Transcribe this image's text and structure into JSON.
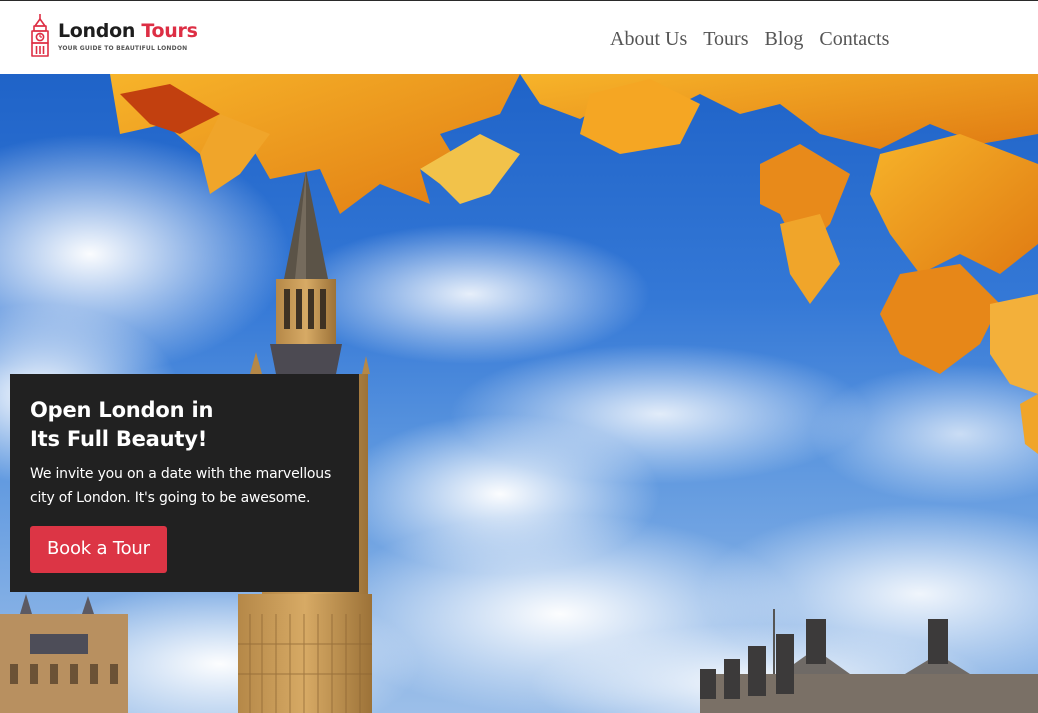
{
  "brand": {
    "title_part1": "London",
    "title_part2": "Tours",
    "tagline": "YOUR GUIDE TO BEAUTIFUL LONDON",
    "icon": "big-ben-icon",
    "accent_color": "#dd2e44"
  },
  "nav": {
    "items": [
      {
        "label": "About Us"
      },
      {
        "label": "Tours"
      },
      {
        "label": "Blog"
      },
      {
        "label": "Contacts"
      }
    ]
  },
  "hero": {
    "title_line1": "Open London in",
    "title_line2": "Its Full Beauty!",
    "text": "We invite you on a date with the marvellous city of London. It's going to be awesome.",
    "cta_label": "Book a Tour",
    "cta_color": "#dc3545",
    "card_color": "#212121"
  }
}
